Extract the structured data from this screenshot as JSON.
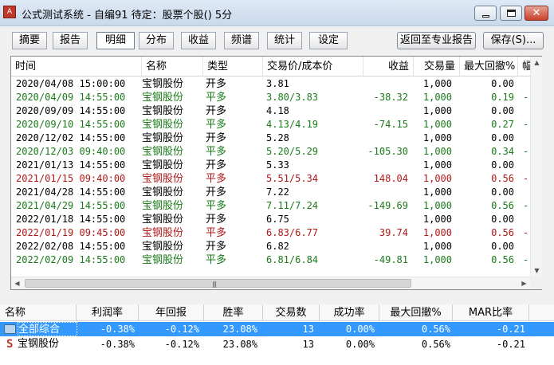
{
  "window": {
    "title": "公式测试系统 - 自编91 待定：股票个股() 5分",
    "icon": "app-logo-icon",
    "controls": {
      "minimize": "minimize-icon",
      "maximize": "maximize-icon",
      "close": "✕"
    }
  },
  "tabs": [
    {
      "label": "摘要",
      "active": false
    },
    {
      "label": "报告",
      "active": false
    },
    {
      "label": "明细",
      "active": true
    },
    {
      "label": "分布",
      "active": false
    },
    {
      "label": "收益",
      "active": false
    },
    {
      "label": "频谱",
      "active": false
    },
    {
      "label": "统计",
      "active": false
    },
    {
      "label": "设定",
      "active": false
    }
  ],
  "toolbar": {
    "back_label": "返回至专业报告",
    "save_label": "保存(S)..."
  },
  "detail_table": {
    "columns": [
      "时间",
      "名称",
      "类型",
      "交易价/成本价",
      "收益",
      "交易量",
      "最大回撤%",
      "幅"
    ],
    "rows": [
      {
        "time": "2020/04/08 15:00:00",
        "name": "宝钢股份",
        "type": "开多",
        "price": "3.81",
        "profit": "",
        "qty": "1,000",
        "drawdown": "0.00",
        "extra": "",
        "color": "black"
      },
      {
        "time": "2020/04/09 14:55:00",
        "name": "宝钢股份",
        "type": "平多",
        "price": "3.80/3.83",
        "profit": "-38.32",
        "qty": "1,000",
        "drawdown": "0.19",
        "extra": "-",
        "color": "green"
      },
      {
        "time": "2020/09/09 14:55:00",
        "name": "宝钢股份",
        "type": "开多",
        "price": "4.18",
        "profit": "",
        "qty": "1,000",
        "drawdown": "0.00",
        "extra": "",
        "color": "black"
      },
      {
        "time": "2020/09/10 14:55:00",
        "name": "宝钢股份",
        "type": "平多",
        "price": "4.13/4.19",
        "profit": "-74.15",
        "qty": "1,000",
        "drawdown": "0.27",
        "extra": "-",
        "color": "green"
      },
      {
        "time": "2020/12/02 14:55:00",
        "name": "宝钢股份",
        "type": "开多",
        "price": "5.28",
        "profit": "",
        "qty": "1,000",
        "drawdown": "0.00",
        "extra": "",
        "color": "black"
      },
      {
        "time": "2020/12/03 09:40:00",
        "name": "宝钢股份",
        "type": "平多",
        "price": "5.20/5.29",
        "profit": "-105.30",
        "qty": "1,000",
        "drawdown": "0.34",
        "extra": "-",
        "color": "green"
      },
      {
        "time": "2021/01/13 14:55:00",
        "name": "宝钢股份",
        "type": "开多",
        "price": "5.33",
        "profit": "",
        "qty": "1,000",
        "drawdown": "0.00",
        "extra": "",
        "color": "black"
      },
      {
        "time": "2021/01/15 09:40:00",
        "name": "宝钢股份",
        "type": "平多",
        "price": "5.51/5.34",
        "profit": "148.04",
        "qty": "1,000",
        "drawdown": "0.56",
        "extra": "-",
        "color": "red"
      },
      {
        "time": "2021/04/28 14:55:00",
        "name": "宝钢股份",
        "type": "开多",
        "price": "7.22",
        "profit": "",
        "qty": "1,000",
        "drawdown": "0.00",
        "extra": "",
        "color": "black"
      },
      {
        "time": "2021/04/29 14:55:00",
        "name": "宝钢股份",
        "type": "平多",
        "price": "7.11/7.24",
        "profit": "-149.69",
        "qty": "1,000",
        "drawdown": "0.56",
        "extra": "-",
        "color": "green"
      },
      {
        "time": "2022/01/18 14:55:00",
        "name": "宝钢股份",
        "type": "开多",
        "price": "6.75",
        "profit": "",
        "qty": "1,000",
        "drawdown": "0.00",
        "extra": "",
        "color": "black"
      },
      {
        "time": "2022/01/19 09:45:00",
        "name": "宝钢股份",
        "type": "平多",
        "price": "6.83/6.77",
        "profit": "39.74",
        "qty": "1,000",
        "drawdown": "0.56",
        "extra": "-",
        "color": "red"
      },
      {
        "time": "2022/02/08 14:55:00",
        "name": "宝钢股份",
        "type": "开多",
        "price": "6.82",
        "profit": "",
        "qty": "1,000",
        "drawdown": "0.00",
        "extra": "",
        "color": "black"
      },
      {
        "time": "2022/02/09 14:55:00",
        "name": "宝钢股份",
        "type": "平多",
        "price": "6.81/6.84",
        "profit": "-49.81",
        "qty": "1,000",
        "drawdown": "0.56",
        "extra": "-",
        "color": "green"
      }
    ]
  },
  "scroll": {
    "up": "▲",
    "down": "▼",
    "left": "◀",
    "right": "▶",
    "grip": "|||"
  },
  "summary_table": {
    "columns": [
      "名称",
      "利润率",
      "年回报",
      "胜率",
      "交易数",
      "成功率",
      "最大回撤%",
      "MAR比率"
    ],
    "rows": [
      {
        "icon": "folder-icon",
        "name": "全部综合",
        "profit_rate": "-0.38%",
        "annual": "-0.12%",
        "win_rate": "23.08%",
        "trades": "13",
        "success": "0.00%",
        "drawdown": "0.56%",
        "mar": "-0.21",
        "selected": true
      },
      {
        "icon": "stock-s-icon",
        "icon_text": "S",
        "name": "宝钢股份",
        "profit_rate": "-0.38%",
        "annual": "-0.12%",
        "win_rate": "23.08%",
        "trades": "13",
        "success": "0.00%",
        "drawdown": "0.56%",
        "mar": "-0.21",
        "selected": false
      }
    ]
  },
  "colors": {
    "profit_negative": "#1a7a1a",
    "profit_positive": "#b01818",
    "selection": "#3399ff"
  }
}
